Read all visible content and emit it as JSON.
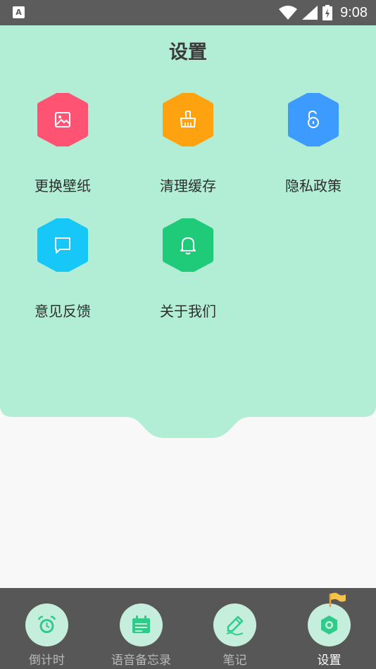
{
  "status_bar": {
    "left_badge": "A",
    "time": "9:08",
    "icons": [
      "wifi-icon",
      "signal-icon",
      "battery-charging-icon"
    ]
  },
  "page": {
    "title": "设置"
  },
  "settings_items": [
    {
      "label": "更换壁纸",
      "icon": "image-icon",
      "color": "#ff5373"
    },
    {
      "label": "清理缓存",
      "icon": "broom-icon",
      "color": "#ffa20f"
    },
    {
      "label": "隐私政策",
      "icon": "lock-icon",
      "color": "#3d9bff"
    },
    {
      "label": "意见反馈",
      "icon": "message-icon",
      "color": "#16c7f7"
    },
    {
      "label": "关于我们",
      "icon": "bell-icon",
      "color": "#1fcb78"
    }
  ],
  "bottom_nav": {
    "active": "设置",
    "items": [
      {
        "label": "倒计时",
        "icon": "alarm-clock-icon"
      },
      {
        "label": "语音备忘录",
        "icon": "calendar-icon"
      },
      {
        "label": "笔记",
        "icon": "pen-icon"
      },
      {
        "label": "设置",
        "icon": "hex-nut-icon"
      }
    ]
  },
  "colors": {
    "header_green": "#b2eed6",
    "nav_background": "#575757",
    "nav_circle": "#c6eedc",
    "nav_icon": "#2fcb8a"
  }
}
